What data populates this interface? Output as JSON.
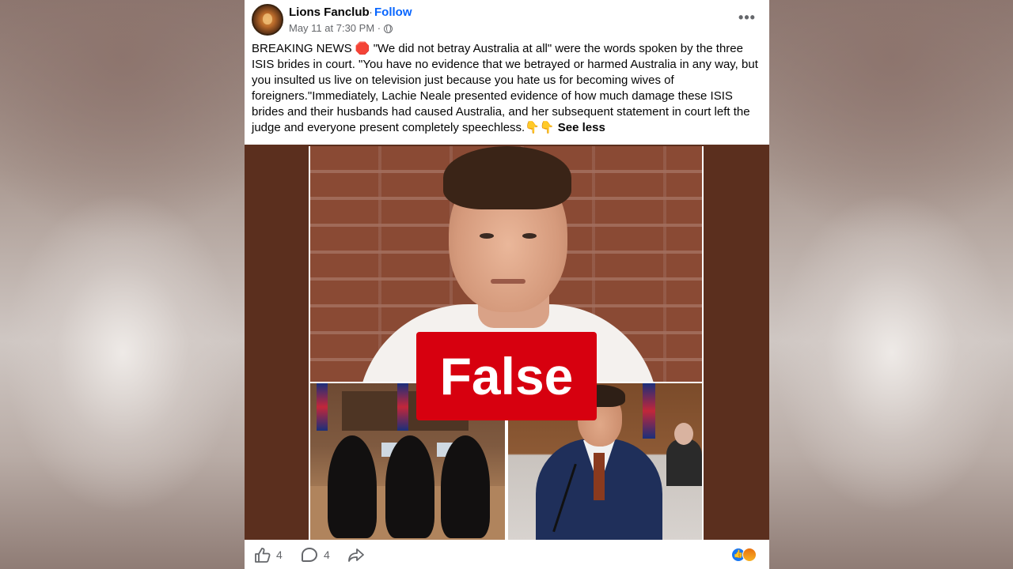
{
  "post": {
    "page_name": "Lions Fanclub",
    "separator": "·",
    "follow_label": "Follow",
    "timestamp": "May 11 at 7:30 PM ·",
    "more_options": "•••",
    "text": "BREAKING NEWS 🛑 \"We did not betray Australia at all\" were the words spoken by the three ISIS brides in court. \"You have no evidence that we betrayed or harmed Australia in any way, but you insulted us live on television just because you hate us for becoming wives of foreigners.\"Immediately, Lachie Neale presented evidence of how much damage these ISIS brides and their husbands had caused Australia, and her subsequent statement in court left the judge and everyone present completely speechless.👇👇",
    "see_less_label": "See less"
  },
  "media": {
    "overlay_label": "False"
  },
  "footer": {
    "like_count": "4",
    "comment_count": "4",
    "reaction_icons": [
      "like-icon",
      "angry-icon"
    ]
  },
  "colors": {
    "follow_blue": "#0866ff",
    "false_red": "#d7000f",
    "media_bg": "#5b2f1e"
  }
}
